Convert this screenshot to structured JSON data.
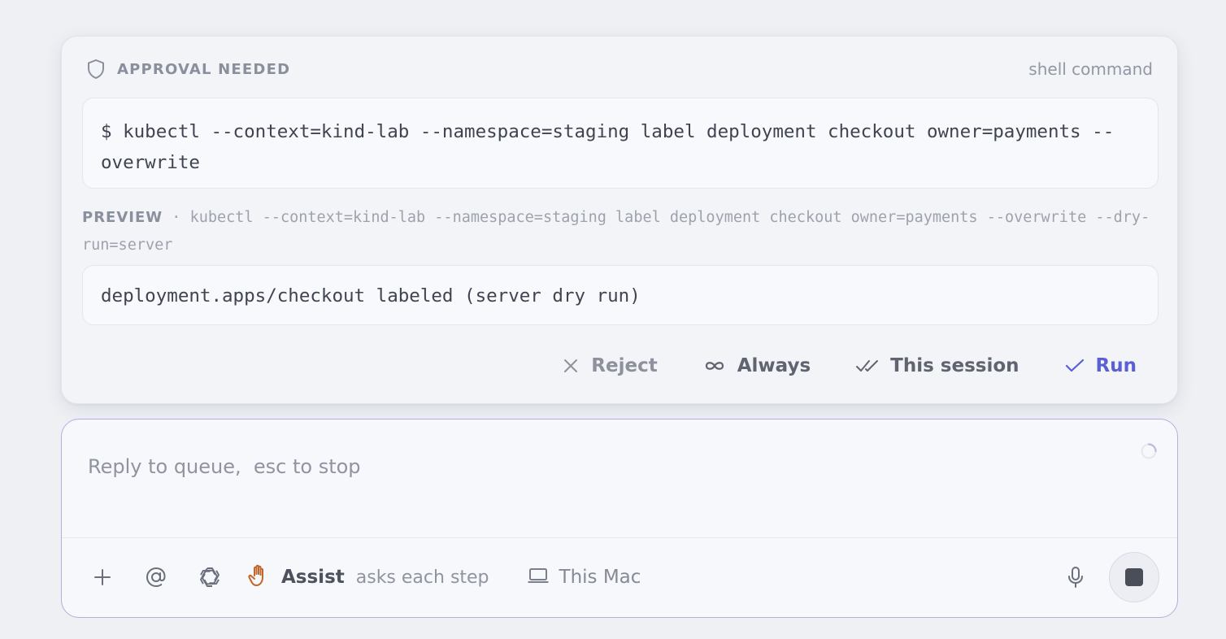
{
  "approval": {
    "title": "APPROVAL NEEDED",
    "kind": "shell command",
    "command_prompt": "$",
    "command": "kubectl --context=kind-lab --namespace=staging label deployment checkout owner=payments --overwrite",
    "preview_label": "PREVIEW",
    "preview_separator": "·",
    "preview_command": "kubectl --context=kind-lab --namespace=staging label deployment checkout owner=payments --overwrite --dry-run=server",
    "preview_result": "deployment.apps/checkout labeled (server dry run)",
    "actions": {
      "reject": "Reject",
      "always": "Always",
      "session": "This session",
      "run": "Run"
    },
    "accent_color": "#5a5fd6"
  },
  "composer": {
    "placeholder": "Reply to queue,  esc to stop",
    "assist_label": "Assist",
    "assist_sub": "asks each step",
    "machine_label": "This Mac",
    "icons": [
      "plus-icon",
      "at-icon",
      "openai-icon",
      "hand-icon",
      "laptop-icon",
      "mic-icon",
      "stop-icon"
    ]
  }
}
